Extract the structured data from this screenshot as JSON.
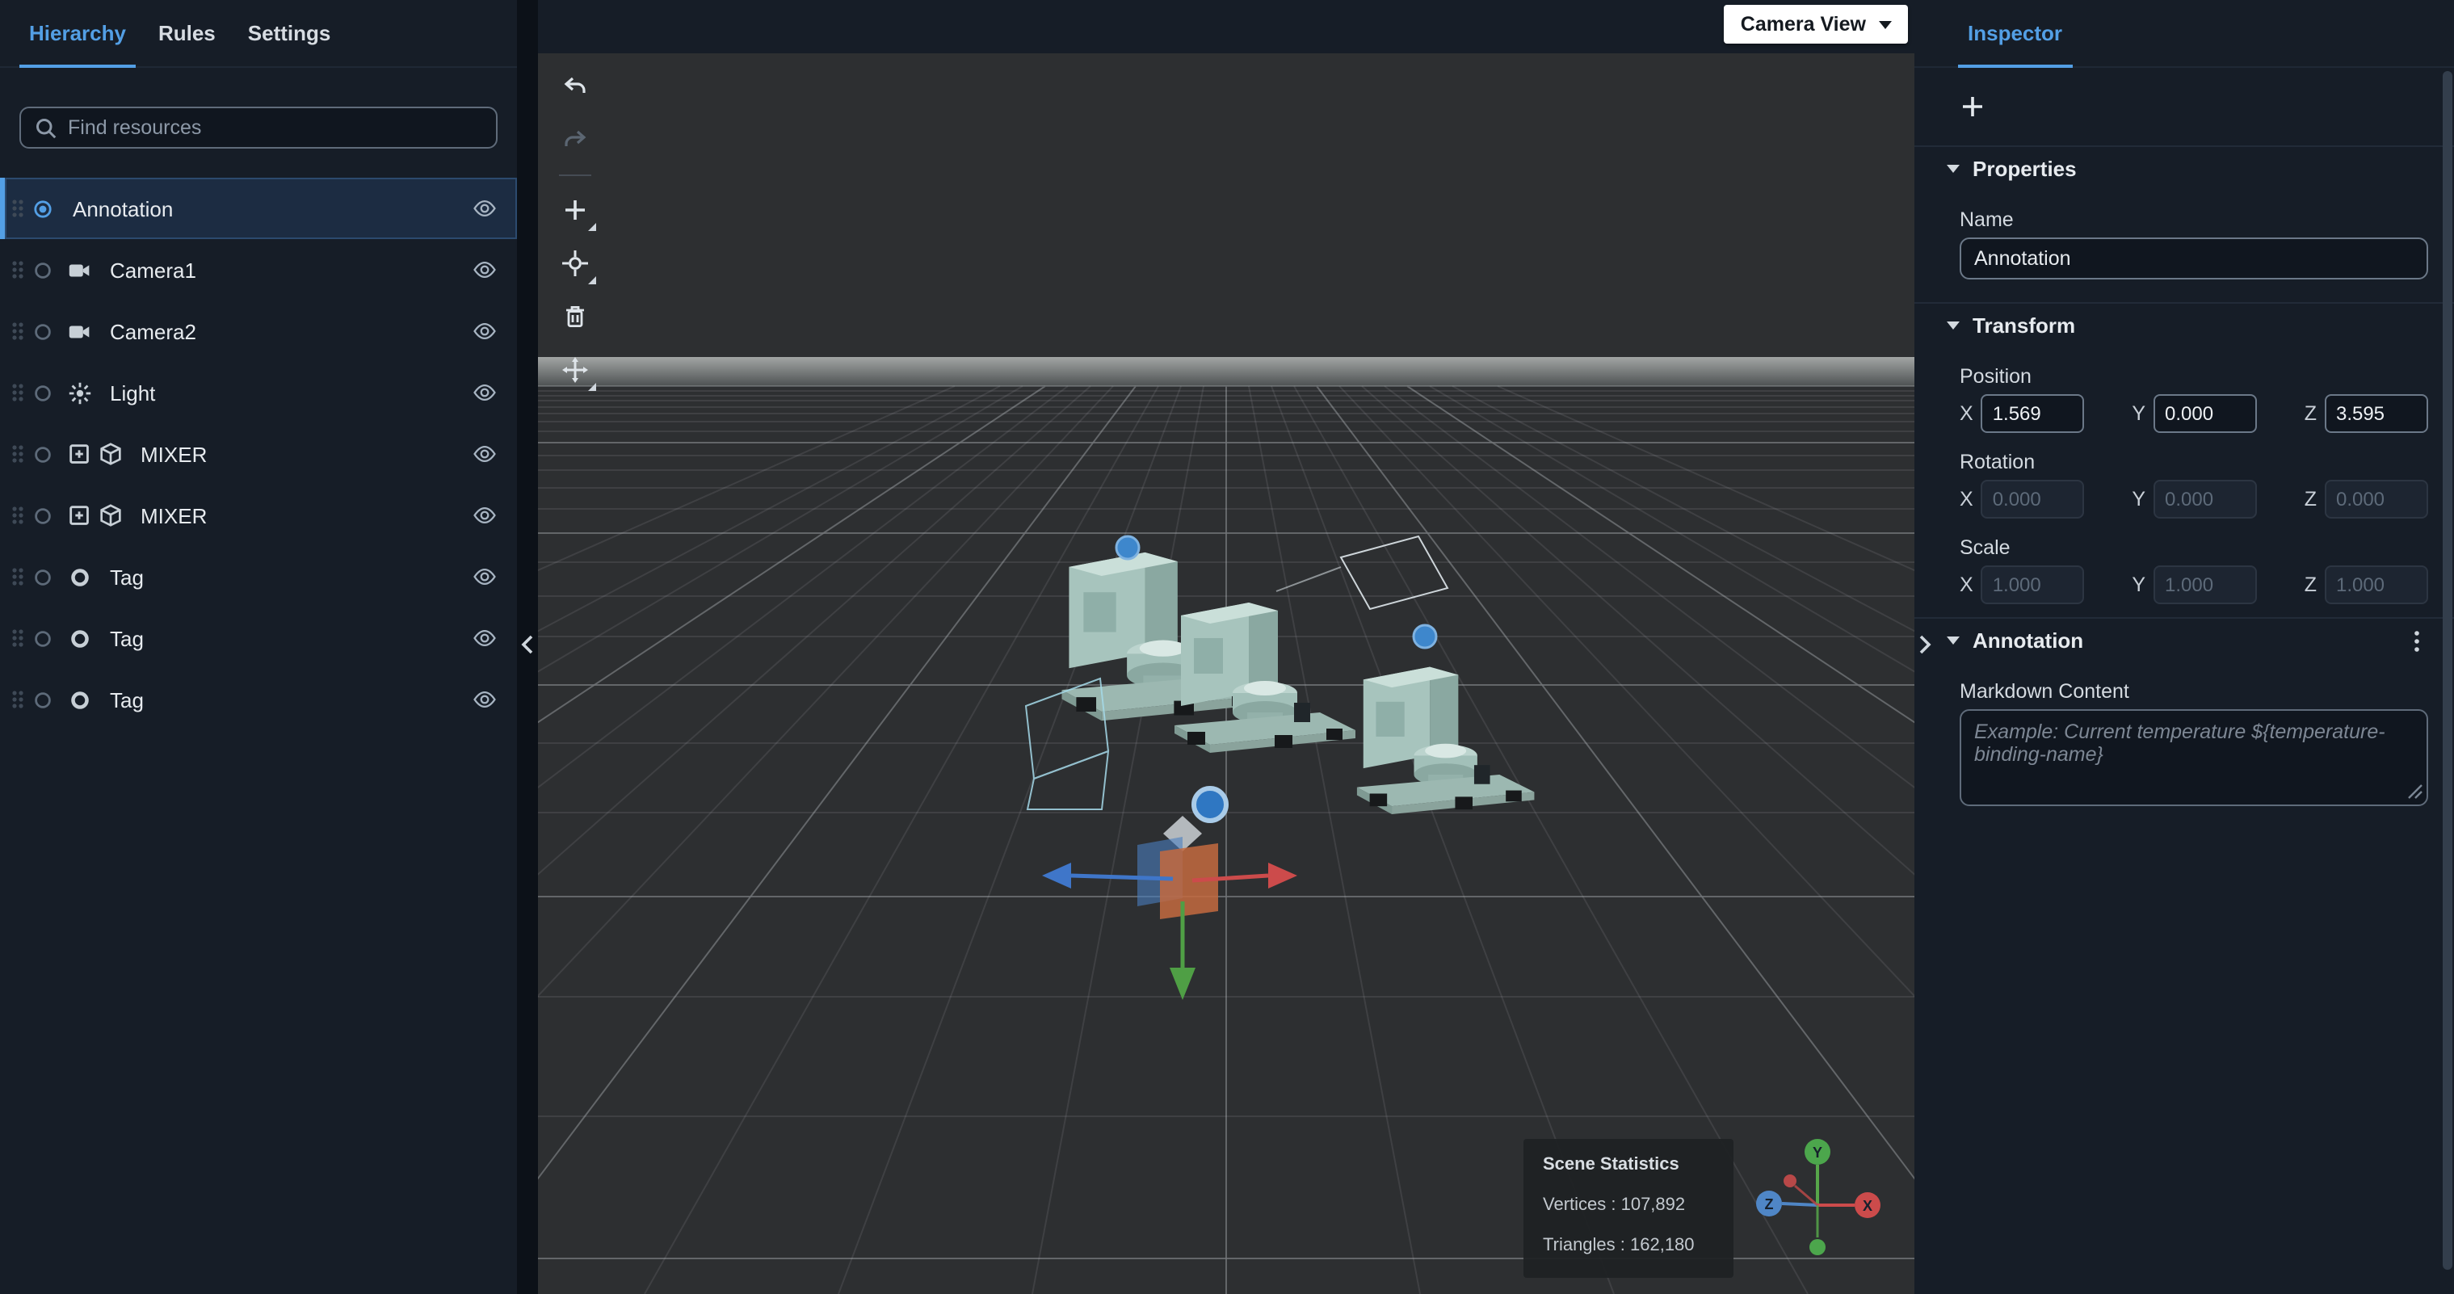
{
  "left_panel": {
    "tabs": [
      {
        "label": "Hierarchy"
      },
      {
        "label": "Rules"
      },
      {
        "label": "Settings"
      }
    ],
    "search": {
      "placeholder": "Find resources"
    },
    "items": [
      {
        "label": "Annotation"
      },
      {
        "label": "Camera1"
      },
      {
        "label": "Camera2"
      },
      {
        "label": "Light"
      },
      {
        "label": "MIXER"
      },
      {
        "label": "MIXER"
      },
      {
        "label": "Tag"
      },
      {
        "label": "Tag"
      },
      {
        "label": "Tag"
      }
    ]
  },
  "viewport": {
    "camera_view_label": "Camera View",
    "stats": {
      "title": "Scene Statistics",
      "vertices": "Vertices : 107,892",
      "triangles": "Triangles : 162,180"
    },
    "axis": {
      "x": "X",
      "y": "Y",
      "z": "Z"
    }
  },
  "inspector": {
    "tab_label": "Inspector",
    "properties": {
      "title": "Properties",
      "name_label": "Name",
      "name_value": "Annotation"
    },
    "transform": {
      "title": "Transform",
      "position_label": "Position",
      "rotation_label": "Rotation",
      "scale_label": "Scale",
      "axis_labels": [
        "X",
        "Y",
        "Z"
      ],
      "position": [
        "1.569",
        "0.000",
        "3.595"
      ],
      "rotation": [
        "0.000",
        "0.000",
        "0.000"
      ],
      "scale": [
        "1.000",
        "1.000",
        "1.000"
      ]
    },
    "annotation": {
      "title": "Annotation",
      "markdown_label": "Markdown Content",
      "markdown_placeholder": "Example: Current temperature ${temperature-binding-name}"
    }
  },
  "colors": {
    "accent": "#539fe5",
    "panel_bg": "#161d27",
    "canvas_bg": "#2d2f31"
  }
}
